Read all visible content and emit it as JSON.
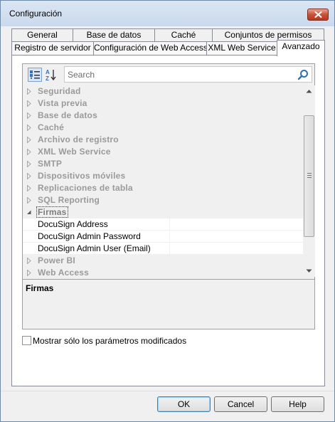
{
  "window": {
    "title": "Configuración"
  },
  "tabs": {
    "row1": [
      "General",
      "Base de datos",
      "Caché",
      "Conjuntos de permisos"
    ],
    "row2": [
      "Registro de servidor",
      "Configuración de Web Access",
      "XML Web Service",
      "Avanzado"
    ],
    "active": "Avanzado"
  },
  "toolbar": {
    "categorized_icon": "categorized-view-icon",
    "alphabetical_icon": "sort-az-icon",
    "search_placeholder": "Search",
    "search_value": ""
  },
  "categories": [
    {
      "label": "Seguridad",
      "expanded": false
    },
    {
      "label": "Vista previa",
      "expanded": false
    },
    {
      "label": "Base de datos",
      "expanded": false
    },
    {
      "label": "Caché",
      "expanded": false
    },
    {
      "label": "Archivo de registro",
      "expanded": false
    },
    {
      "label": "XML Web Service",
      "expanded": false
    },
    {
      "label": "SMTP",
      "expanded": false
    },
    {
      "label": "Dispositivos móviles",
      "expanded": false
    },
    {
      "label": "Replicaciones de tabla",
      "expanded": false
    },
    {
      "label": "SQL Reporting",
      "expanded": false
    },
    {
      "label": "Firmas",
      "expanded": true
    },
    {
      "label": "Power BI",
      "expanded": false
    },
    {
      "label": "Web Access",
      "expanded": false
    }
  ],
  "properties": [
    {
      "name": "DocuSign Address",
      "value": ""
    },
    {
      "name": "DocuSign Admin Password",
      "value": ""
    },
    {
      "name": "DocuSign Admin User (Email)",
      "value": ""
    }
  ],
  "description": {
    "title": "Firmas"
  },
  "options": {
    "show_modified_only_label": "Mostrar sólo los parámetros modificados",
    "show_modified_only_checked": false
  },
  "buttons": {
    "ok": "OK",
    "cancel": "Cancel",
    "help": "Help"
  },
  "colors": {
    "title_bar": "#c9d9ec",
    "close_button": "#c9513a",
    "default_button_border": "#3c7fb1",
    "category_text": "#9a9a9a"
  }
}
